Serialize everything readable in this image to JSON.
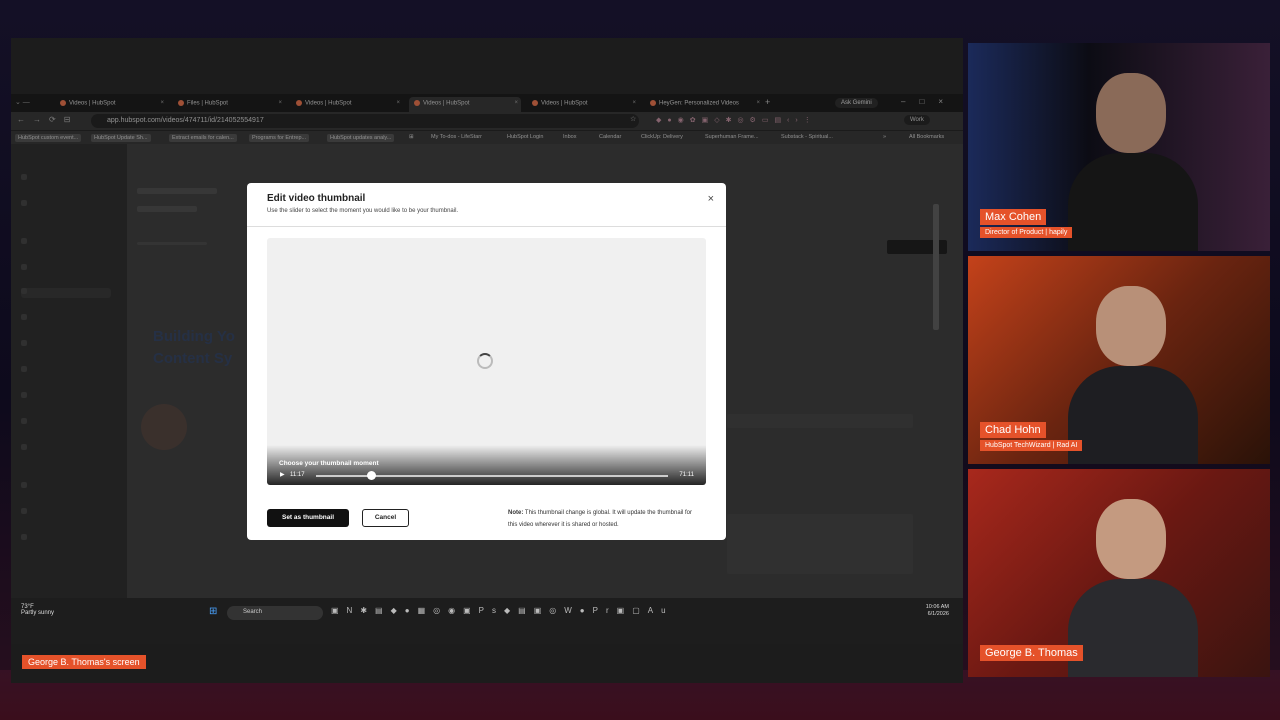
{
  "browser": {
    "tabs": [
      {
        "label": "Videos | HubSpot",
        "active": false
      },
      {
        "label": "Files | HubSpot",
        "active": false
      },
      {
        "label": "Videos | HubSpot",
        "active": false
      },
      {
        "label": "Videos | HubSpot",
        "active": true
      },
      {
        "label": "Videos | HubSpot",
        "active": false
      },
      {
        "label": "HeyGen: Personalized Videos",
        "active": false
      }
    ],
    "url": "app.hubspot.com/videos/474711/id/214052554917",
    "ask_gemini": "Ask Gemini",
    "profile": "Work",
    "bookmarks": [
      "HubSpot custom event...",
      "HubSpot Update Sh...",
      "Extract emails for calen...",
      "Programs for Entrep...",
      "HubSpot updates analy...",
      "My To-dos - LifeStarr",
      "HubSpot Login",
      "Inbox",
      "Calendar",
      "ClickUp: Delivery",
      "Superhuman Frame...",
      "Substack - Spiritual...",
      "All Bookmarks"
    ]
  },
  "modal": {
    "title": "Edit video thumbnail",
    "subtitle": "Use the slider to select the moment you would like to be your thumbnail.",
    "slider_label": "Choose your thumbnail moment",
    "current_time": "11:17",
    "total_time": "71:11",
    "primary_button": "Set as thumbnail",
    "secondary_button": "Cancel",
    "note_bold": "Note:",
    "note_text": " This thumbnail change is global. It will update the thumbnail for this video wherever it is shared or hosted."
  },
  "background_page": {
    "heading_line1": "Building Yo",
    "heading_line2": "Content Sy"
  },
  "taskbar": {
    "temp": "73°F",
    "weather": "Partly sunny",
    "search": "Search",
    "time": "10:06 AM",
    "date": "6/1/2026"
  },
  "screen_share_label": "George B. Thomas's screen",
  "participants": [
    {
      "name": "Max Cohen",
      "title": "Director of Product | hapily"
    },
    {
      "name": "Chad Hohn",
      "title": "HubSpot TechWizard | Rad AI"
    },
    {
      "name": "George B. Thomas",
      "title": ""
    }
  ],
  "colors": {
    "accent": "#e5522a",
    "modal_bg": "#ffffff",
    "primary_btn": "#111111"
  }
}
